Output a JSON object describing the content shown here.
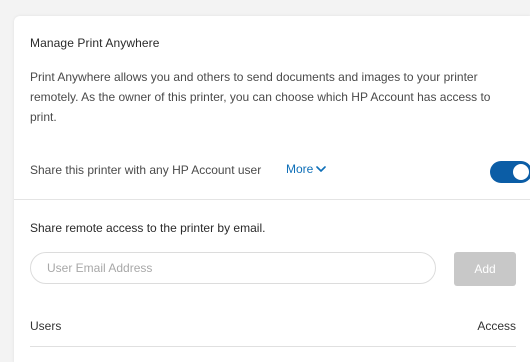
{
  "panel": {
    "title": "Manage Print Anywhere",
    "description": "Print Anywhere allows you and others to send documents and images to your printer remotely. As the owner of this printer, you can choose which HP Account has access to print.",
    "share_label": "Share this printer with any HP Account user",
    "more_label": "More",
    "more_icon": "chevron-down-icon",
    "toggle_on": true,
    "toggle_color": "#0b5da6",
    "link_color": "#0e6fb8"
  },
  "remote": {
    "label": "Share remote access to the printer by email.",
    "email_value": "",
    "email_placeholder": "User Email Address",
    "add_label": "Add",
    "add_color": "#c8c8c8"
  },
  "table": {
    "columns": [
      "Users",
      "Access"
    ]
  }
}
